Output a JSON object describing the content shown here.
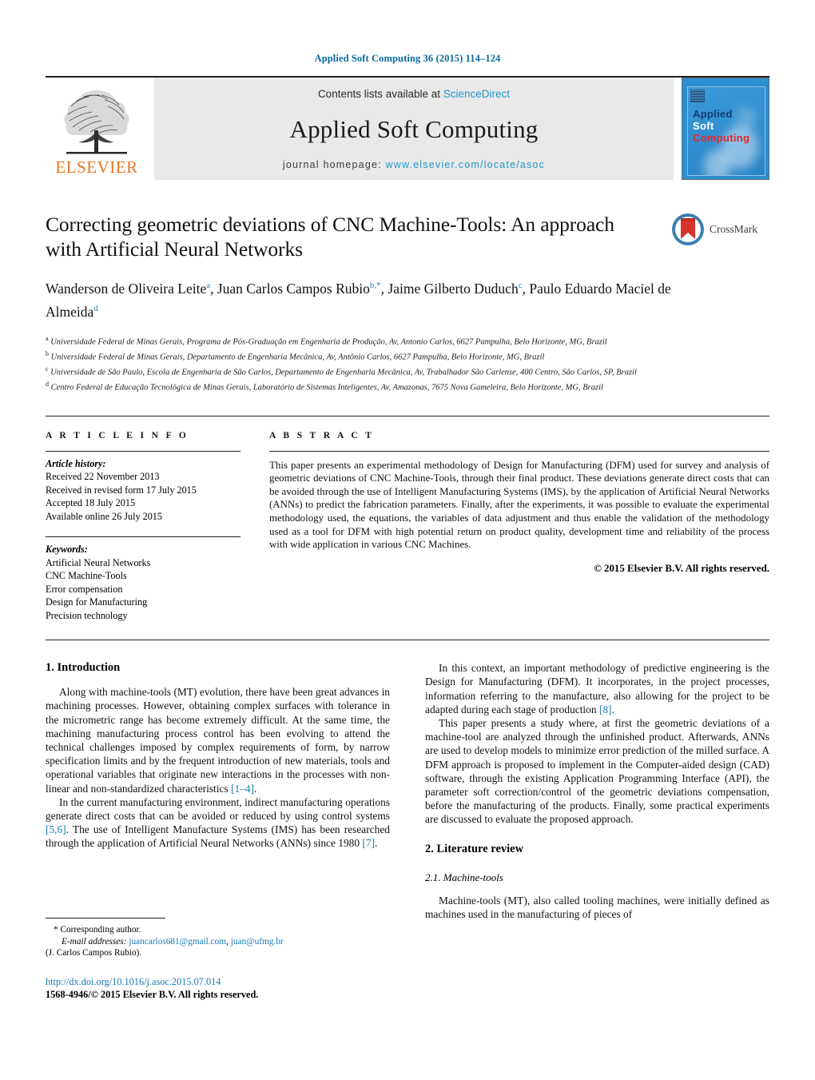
{
  "running_head": "Applied Soft Computing 36 (2015) 114–124",
  "masthead": {
    "publisher": "ELSEVIER",
    "contents_prefix": "Contents lists available at ",
    "contents_link": "ScienceDirect",
    "journal_name": "Applied Soft Computing",
    "homepage_prefix": "journal homepage: ",
    "homepage_url": "www.elsevier.com/locate/asoc",
    "cover": {
      "line1": "Applied",
      "line2": "Soft",
      "line3": "Computing"
    },
    "colors": {
      "link": "#2196c4",
      "elsevier_orange": "#e87422",
      "cover_blue": "#2b8fd1",
      "cover_red": "#e8252a"
    }
  },
  "crossmark": {
    "label": "CrossMark"
  },
  "article": {
    "title": "Correcting geometric deviations of CNC Machine-Tools: An approach with Artificial Neural Networks",
    "authors": [
      {
        "name": "Wanderson de Oliveira Leite",
        "marks": "a",
        "sep": ", "
      },
      {
        "name": "Juan Carlos Campos Rubio",
        "marks": "b,*",
        "sep": ", "
      },
      {
        "name": "Jaime Gilberto Duduch",
        "marks": "c",
        "sep": ", "
      },
      {
        "name": "Paulo Eduardo Maciel de Almeida",
        "marks": "d",
        "sep": ""
      }
    ],
    "affiliations": [
      {
        "mark": "a",
        "text": "Universidade Federal de Minas Gerais, Programa de Pós-Graduação em Engenharia de Produção, Av, Antonio Carlos, 6627 Pampulha, Belo Horizonte, MG, Brazil"
      },
      {
        "mark": "b",
        "text": "Universidade Federal de Minas Gerais, Departamento de Engenharia Mecânica, Av, Antônio Carlos, 6627 Pampulha, Belo Horizonte, MG, Brazil"
      },
      {
        "mark": "c",
        "text": "Universidade de São Paulo, Escola de Engenharia de São Carlos, Departamento de Engenharia Mecânica, Av, Trabalhador São Carlense, 400 Centro, São Carlos, SP, Brazil"
      },
      {
        "mark": "d",
        "text": "Centro Federal de Educação Tecnológica de Minas Gerais, Laboratório de Sistemas Inteligentes, Av, Amazonas, 7675 Nova Gameleira, Belo Horizonte, MG, Brazil"
      }
    ]
  },
  "article_info": {
    "heading": "A R T I C L E    I N F O",
    "history_label": "Article history:",
    "history": [
      "Received 22 November 2013",
      "Received in revised form 17 July 2015",
      "Accepted 18 July 2015",
      "Available online 26 July 2015"
    ],
    "keywords_label": "Keywords:",
    "keywords": [
      "Artificial Neural Networks",
      "CNC Machine-Tools",
      "Error compensation",
      "Design for Manufacturing",
      "Precision technology"
    ]
  },
  "abstract": {
    "heading": "A B S T R A C T",
    "text": "This paper presents an experimental methodology of Design for Manufacturing (DFM) used for survey and analysis of geometric deviations of CNC Machine-Tools, through their final product. These deviations generate direct costs that can be avoided through the use of Intelligent Manufacturing Systems (IMS), by the application of Artificial Neural Networks (ANNs) to predict the fabrication parameters. Finally, after the experiments, it was possible to evaluate the experimental methodology used, the equations, the variables of data adjustment and thus enable the validation of the methodology used as a tool for DFM with high potential return on product quality, development time and reliability of the process with wide application in various CNC Machines.",
    "copyright": "© 2015 Elsevier B.V. All rights reserved."
  },
  "body": {
    "left": {
      "section_heading": "1.  Introduction",
      "para1_a": "Along with machine-tools (MT) evolution, there have been great advances in machining processes. However, obtaining complex surfaces with tolerance in the micrometric range has become extremely difficult. At the same time, the machining manufacturing process control has been evolving to attend the technical challenges imposed by complex requirements of form, by narrow specification limits and by the frequent introduction of new materials, tools and operational variables that originate new interactions in the processes with non-linear and non-standardized characteristics ",
      "para1_cite": "[1–4]",
      "para1_b": ".",
      "para2_a": "In the current manufacturing environment, indirect manufacturing operations generate direct costs that can be avoided or reduced by using control systems ",
      "para2_cite1": "[5,6]",
      "para2_b": ". The use of Intelligent Manufacture Systems (IMS) has been researched through the application of Artificial Neural Networks (ANNs) since 1980 ",
      "para2_cite2": "[7]",
      "para2_c": "."
    },
    "right": {
      "para1_a": "In this context, an important methodology of predictive engineering is the Design for Manufacturing (DFM). It incorporates, in the project processes, information referring to the manufacture, also allowing for the project to be adapted during each stage of production ",
      "para1_cite": "[8]",
      "para1_b": ".",
      "para2": "This paper presents a study where, at first the geometric deviations of a machine-tool are analyzed through the unfinished product. Afterwards, ANNs are used to develop models to minimize error prediction of the milled surface. A DFM approach is proposed to implement in the Computer-aided design (CAD) software, through the existing Application Programming Interface (API), the parameter soft correction/control of the geometric deviations compensation, before the manufacturing of the products. Finally, some practical experiments are discussed to evaluate the proposed approach.",
      "section_heading": "2.  Literature review",
      "subsection_heading": "2.1.  Machine-tools",
      "para3": "Machine-tools (MT), also called tooling machines, were initially defined as machines used in the manufacturing of pieces of"
    }
  },
  "footnote": {
    "corresponding": "*  Corresponding author.",
    "email_label": "E-mail addresses:",
    "email1": "juancarlos681@gmail.com",
    "email_sep": ", ",
    "email2": "juan@ufmg.br",
    "email_owner": "(J. Carlos Campos Rubio)."
  },
  "doi_block": {
    "doi": "http://dx.doi.org/10.1016/j.asoc.2015.07.014",
    "issn": "1568-4946/© 2015 Elsevier B.V. All rights reserved."
  }
}
